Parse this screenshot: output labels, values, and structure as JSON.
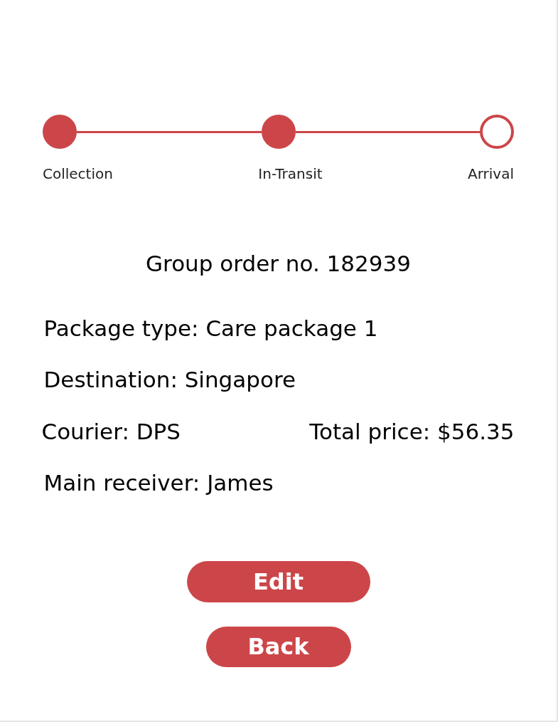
{
  "stepper": [
    {
      "label": "Collection",
      "done": true
    },
    {
      "label": "In-Transit",
      "done": true
    },
    {
      "label": "Arrival",
      "done": false
    }
  ],
  "order_title": "Group order no. 182939",
  "details": [
    {
      "kind": "single",
      "text": "Package type: Care package 1"
    },
    {
      "kind": "single",
      "text": "Destination: Singapore"
    },
    {
      "kind": "pair",
      "text": "Courier: DPS",
      "text_2": "Total price: $56.35"
    },
    {
      "kind": "single",
      "text": "Main receiver: James"
    }
  ],
  "buttons": [
    "Edit",
    "Back"
  ]
}
